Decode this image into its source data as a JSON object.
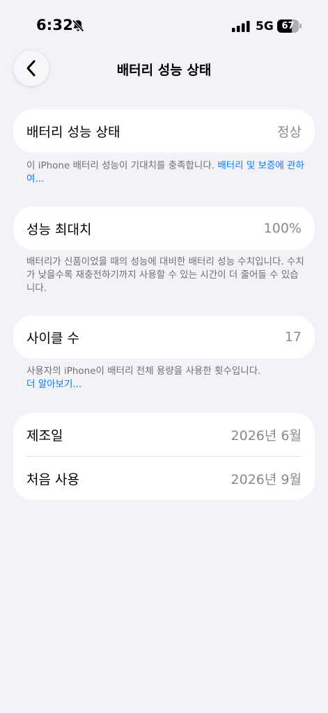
{
  "status_bar": {
    "time": "6:32",
    "network": "5G",
    "battery": "67",
    "battery_level": 0.67
  },
  "nav": {
    "title": "배터리 성능 상태"
  },
  "health": {
    "label": "배터리 성능 상태",
    "value": "정상"
  },
  "health_note": {
    "text": "이 iPhone 배터리 성능이 기대치를 충족합니다. ",
    "link": "배터리 및 보증에 관하여..."
  },
  "capacity": {
    "label": "성능 최대치",
    "value": "100%"
  },
  "capacity_note": {
    "text": "배터리가 신품이었을 때의 성능에 대비한 배터리 성능 수치입니다. 수치가 낮을수록 재충전하기까지 사용할 수 있는 시간이 더 줄어들 수 있습니다."
  },
  "cycles": {
    "label": "사이클 수",
    "value": "17"
  },
  "cycles_note": {
    "text": "사용자의 iPhone이 배터리 전체 용량을 사용한 횟수입니다.",
    "link": "더 알아보기..."
  },
  "dates": {
    "manufacture": {
      "label": "제조일",
      "value": "2026년 6월"
    },
    "first_use": {
      "label": "처음 사용",
      "value": "2026년 9월"
    }
  },
  "icons": [
    "bell-slash-icon",
    "signal-icon",
    "battery-icon",
    "chevron-left-icon"
  ]
}
